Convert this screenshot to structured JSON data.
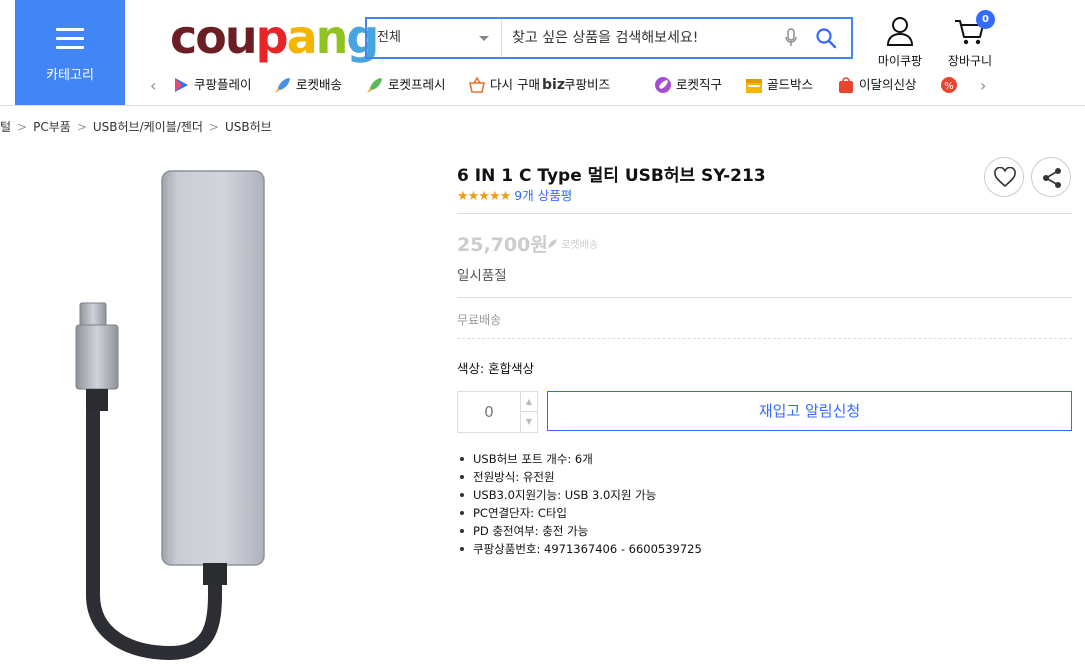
{
  "header": {
    "category_label": "카테고리",
    "logo_letters": [
      "c",
      "o",
      "u",
      "p",
      "a",
      "n",
      "g"
    ],
    "search": {
      "scope": "전체",
      "placeholder": "찾고 싶은 상품을 검색해보세요!"
    },
    "mypage_label": "마이쿠팡",
    "cart_label": "장바구니",
    "cart_count": "0",
    "accent_color": "#346aff"
  },
  "subnav": {
    "items": [
      {
        "label": "쿠팡플레이",
        "icon": "play-icon"
      },
      {
        "label": "로켓배송",
        "icon": "rocket-icon"
      },
      {
        "label": "로켓프레시",
        "icon": "rocket-fresh-icon"
      },
      {
        "label": "다시 구매",
        "icon": "basket-icon"
      },
      {
        "label": "쿠팡비즈",
        "icon": "biz-icon",
        "prefix": "biz"
      },
      {
        "label": "로켓직구",
        "icon": "rocket-global-icon"
      },
      {
        "label": "골드박스",
        "icon": "goldbox-icon"
      },
      {
        "label": "이달의신상",
        "icon": "new-bag-icon"
      }
    ]
  },
  "breadcrumb": [
    "털",
    "PC부품",
    "USB허브/케이블/젠더",
    "USB허브"
  ],
  "product": {
    "title": "6 IN 1 C Type 멀티 USB허브 SY-213",
    "stars": "★★★★★",
    "rating_value": 4.5,
    "review_count": "9개 상품평",
    "price": "25,700원",
    "rocket_tag": "로켓배송",
    "stock_status": "일시품절",
    "shipping": "무료배송",
    "option": "색상: 혼합색상",
    "quantity": "0",
    "restock_button": "재입고 알림신청",
    "specs": [
      "USB허브 포트 개수: 6개",
      "전원방식: 유전원",
      "USB3.0지원기능: USB 3.0지원 가능",
      "PC연결단자: C타입",
      "PD 충전여부: 충전 가능",
      "쿠팡상품번호: 4971367406 - 6600539725"
    ]
  }
}
